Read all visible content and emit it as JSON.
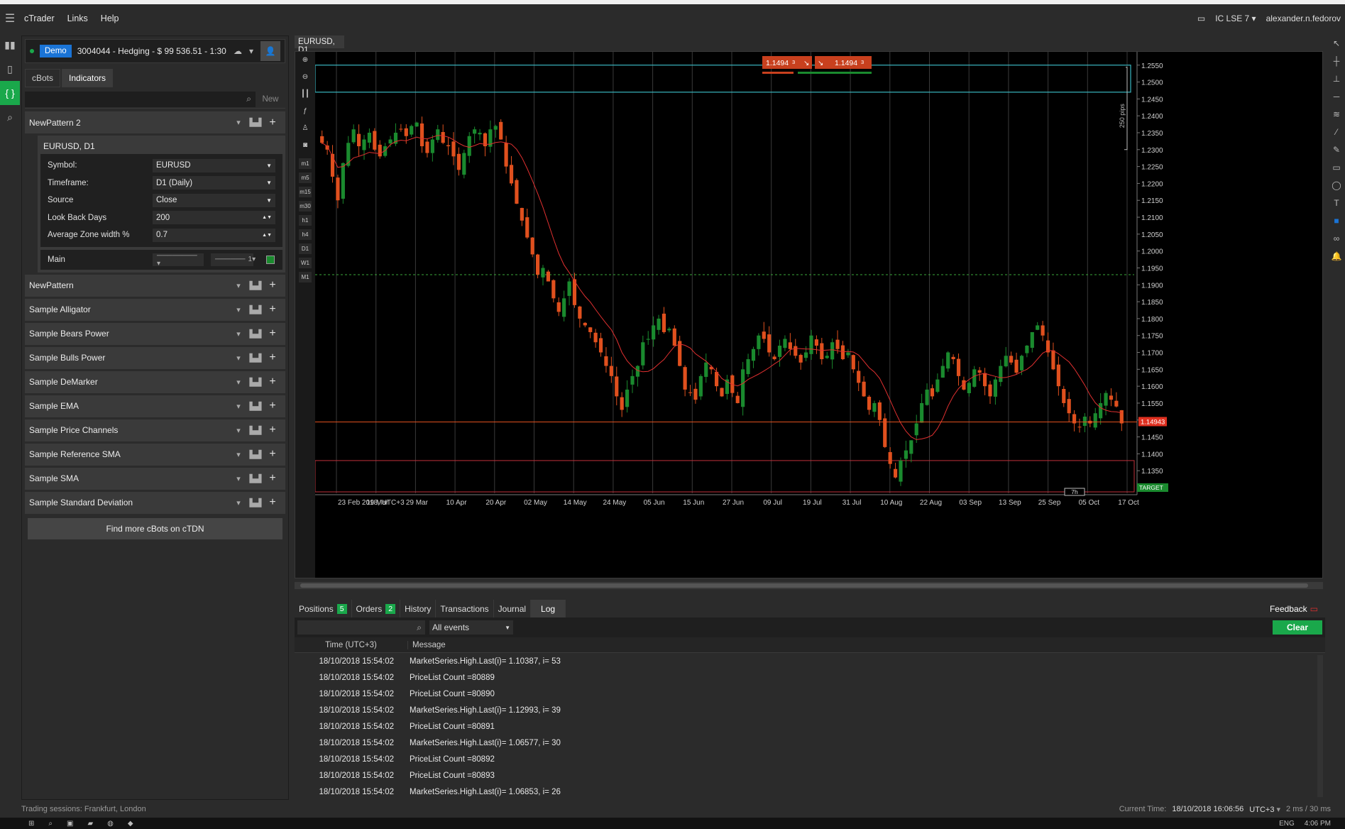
{
  "app": {
    "menu": [
      "cTrader",
      "Links",
      "Help"
    ],
    "broker": "IC LSE 7",
    "user": "alexander.n.fedorov"
  },
  "account": {
    "mode": "Demo",
    "details": "3004044 - Hedging - $ 99 536.51 - 1:30"
  },
  "panel_tabs": [
    "cBots",
    "Indicators"
  ],
  "search": {
    "new_label": "New"
  },
  "expanded_indicator": {
    "name": "NewPattern 2",
    "instance_title": "EURUSD, D1",
    "params": [
      {
        "label": "Symbol:",
        "value": "EURUSD"
      },
      {
        "label": "Timeframe:",
        "value": "D1 (Daily)"
      },
      {
        "label": "Source",
        "value": "Close"
      },
      {
        "label": "Look Back Days",
        "value": "200"
      },
      {
        "label": "Average Zone width %",
        "value": "0.7"
      }
    ],
    "output": {
      "label": "Main",
      "thickness": "1",
      "color": "#1a8a2e"
    }
  },
  "indicators": [
    "NewPattern",
    "Sample Alligator",
    "Sample Bears Power",
    "Sample Bulls Power",
    "Sample DeMarker",
    "Sample EMA",
    "Sample Price Channels",
    "Sample Reference SMA",
    "Sample SMA",
    "Sample Standard Deviation"
  ],
  "find_more": "Find more cBots on cTDN",
  "chart": {
    "tab": "EURUSD, D1",
    "sell_price": "1.1494",
    "sell_sup": "3",
    "buy_price": "1.1494",
    "buy_sup": "3",
    "current_price": "1.14943",
    "target_label": "TARGET",
    "pips_label": "250 pips",
    "countdown": "7h",
    "timeframe_buttons": [
      "m1",
      "m5",
      "m15",
      "m30",
      "h1",
      "h4",
      "D1",
      "W1",
      "M1"
    ],
    "colors": {
      "bull": "#1a8a2e",
      "bear": "#e0501e",
      "ma": "#e03030",
      "zone": "#3ab8c0",
      "support": "#c0303a",
      "dotted": "#3aa83a"
    }
  },
  "chart_data": {
    "type": "candlestick",
    "symbol": "EURUSD",
    "timeframe": "D1",
    "x_ticks": [
      "23 Feb 2018, UTC+3",
      "19 Mar",
      "29 Mar",
      "10 Apr",
      "20 Apr",
      "02 May",
      "14 May",
      "24 May",
      "05 Jun",
      "15 Jun",
      "27 Jun",
      "09 Jul",
      "19 Jul",
      "31 Jul",
      "10 Aug",
      "22 Aug",
      "03 Sep",
      "13 Sep",
      "25 Sep",
      "05 Oct",
      "17 Oct"
    ],
    "y_ticks": [
      "1.2550",
      "1.2500",
      "1.2450",
      "1.2400",
      "1.2350",
      "1.2300",
      "1.2250",
      "1.2200",
      "1.2150",
      "1.2100",
      "1.2050",
      "1.2000",
      "1.1950",
      "1.1900",
      "1.1850",
      "1.1800",
      "1.1750",
      "1.1700",
      "1.1650",
      "1.1600",
      "1.1550",
      "1.1500",
      "1.1450",
      "1.1400",
      "1.1350"
    ],
    "ylim": [
      1.13,
      1.256
    ],
    "close_path": [
      1.232,
      1.23,
      1.222,
      1.215,
      1.226,
      1.232,
      1.236,
      1.231,
      1.233,
      1.235,
      1.23,
      1.228,
      1.231,
      1.233,
      1.235,
      1.236,
      1.234,
      1.237,
      1.238,
      1.231,
      1.229,
      1.233,
      1.236,
      1.232,
      1.231,
      1.228,
      1.224,
      1.229,
      1.234,
      1.236,
      1.235,
      1.231,
      1.236,
      1.237,
      1.233,
      1.225,
      1.22,
      1.214,
      1.209,
      1.204,
      1.199,
      1.193,
      1.195,
      1.191,
      1.186,
      1.182,
      1.186,
      1.191,
      1.184,
      1.18,
      1.178,
      1.176,
      1.173,
      1.17,
      1.166,
      1.163,
      1.157,
      1.153,
      1.159,
      1.163,
      1.166,
      1.173,
      1.174,
      1.178,
      1.18,
      1.176,
      1.177,
      1.172,
      1.166,
      1.159,
      1.158,
      1.156,
      1.163,
      1.167,
      1.165,
      1.16,
      1.157,
      1.162,
      1.158,
      1.155,
      1.165,
      1.168,
      1.171,
      1.175,
      1.174,
      1.17,
      1.168,
      1.172,
      1.174,
      1.171,
      1.169,
      1.167,
      1.17,
      1.175,
      1.172,
      1.168,
      1.169,
      1.173,
      1.171,
      1.168,
      1.17,
      1.165,
      1.161,
      1.157,
      1.153,
      1.155,
      1.15,
      1.142,
      1.137,
      1.133,
      1.138,
      1.141,
      1.144,
      1.149,
      1.155,
      1.159,
      1.157,
      1.162,
      1.166,
      1.17,
      1.168,
      1.163,
      1.159,
      1.161,
      1.165,
      1.164,
      1.16,
      1.157,
      1.162,
      1.166,
      1.169,
      1.167,
      1.164,
      1.169,
      1.172,
      1.176,
      1.178,
      1.175,
      1.17,
      1.165,
      1.16,
      1.155,
      1.152,
      1.149,
      1.148,
      1.151,
      1.149,
      1.152,
      1.155,
      1.158,
      1.156,
      1.154,
      1.149
    ],
    "price_lines": {
      "current": 1.14943,
      "green_dotted": 1.193,
      "zone_top": [
        1.247,
        1.255
      ],
      "support": 1.138
    }
  },
  "bottom": {
    "tabs": [
      {
        "label": "Positions",
        "count": "5"
      },
      {
        "label": "Orders",
        "count": "2"
      },
      {
        "label": "History"
      },
      {
        "label": "Transactions"
      },
      {
        "label": "Journal"
      },
      {
        "label": "Log"
      }
    ],
    "feedback": "Feedback",
    "filter": "All events",
    "clear": "Clear",
    "columns": [
      "Time (UTC+3)",
      "Message"
    ],
    "rows": [
      {
        "time": "18/10/2018 15:54:02",
        "msg": "MarketSeries.High.Last(i)= 1.10387, i= 53"
      },
      {
        "time": "18/10/2018 15:54:02",
        "msg": "PriceList Count =80889"
      },
      {
        "time": "18/10/2018 15:54:02",
        "msg": "PriceList Count =80890"
      },
      {
        "time": "18/10/2018 15:54:02",
        "msg": "MarketSeries.High.Last(i)= 1.12993, i= 39"
      },
      {
        "time": "18/10/2018 15:54:02",
        "msg": "PriceList Count =80891"
      },
      {
        "time": "18/10/2018 15:54:02",
        "msg": "MarketSeries.High.Last(i)= 1.06577, i= 30"
      },
      {
        "time": "18/10/2018 15:54:02",
        "msg": "PriceList Count =80892"
      },
      {
        "time": "18/10/2018 15:54:02",
        "msg": "PriceList Count =80893"
      },
      {
        "time": "18/10/2018 15:54:02",
        "msg": "MarketSeries.High.Last(i)= 1.06853, i= 26"
      }
    ]
  },
  "status": {
    "sessions_label": "Trading sessions:",
    "sessions": "Frankfurt, London",
    "time_label": "Current Time:",
    "time": "18/10/2018 16:06:56",
    "tz": "UTC+3",
    "latency": "2 ms / 30 ms"
  },
  "taskbar": {
    "lang": "ENG",
    "clock": "4:06 PM"
  }
}
